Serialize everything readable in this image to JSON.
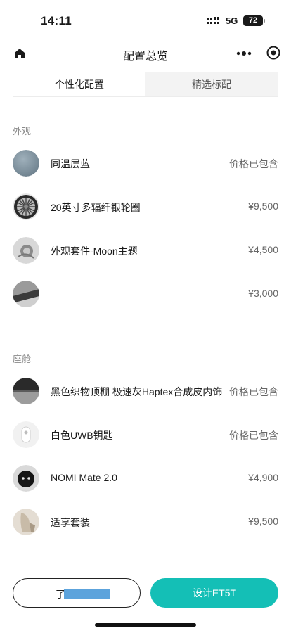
{
  "status": {
    "time": "14:11",
    "network": "5G",
    "battery": "72"
  },
  "nav": {
    "title": "配置总览"
  },
  "tabs": [
    {
      "label": "个性化配置",
      "active": true
    },
    {
      "label": "精选标配",
      "active": false
    }
  ],
  "sections": {
    "exterior": {
      "title": "外观",
      "items": [
        {
          "name": "同温层蓝",
          "price": "价格已包含",
          "thumb": "blue-paint-swatch"
        },
        {
          "name": "20英寸多辐纤银轮圈",
          "price": "¥9,500",
          "thumb": "wheel-image"
        },
        {
          "name": "外观套件-Moon主题",
          "price": "¥4,500",
          "thumb": "exterior-kit-image"
        },
        {
          "name": "",
          "price": "¥3,000",
          "thumb": "car-detail-image"
        }
      ]
    },
    "cabin": {
      "title": "座舱",
      "items": [
        {
          "name": "黑色织物顶棚 极速灰Haptex合成皮内饰",
          "price": "价格已包含",
          "thumb": "interior-image"
        },
        {
          "name": "白色UWB钥匙",
          "price": "价格已包含",
          "thumb": "key-image"
        },
        {
          "name": "NOMI Mate 2.0",
          "price": "¥4,900",
          "thumb": "nomi-image"
        },
        {
          "name": "适享套装",
          "price": "¥9,500",
          "thumb": "seat-package-image"
        }
      ]
    }
  },
  "bottom": {
    "left_label": "了",
    "right_label": "设计ET5T"
  },
  "colors": {
    "accent": "#14bfb6",
    "paint": "#7f93a0"
  }
}
